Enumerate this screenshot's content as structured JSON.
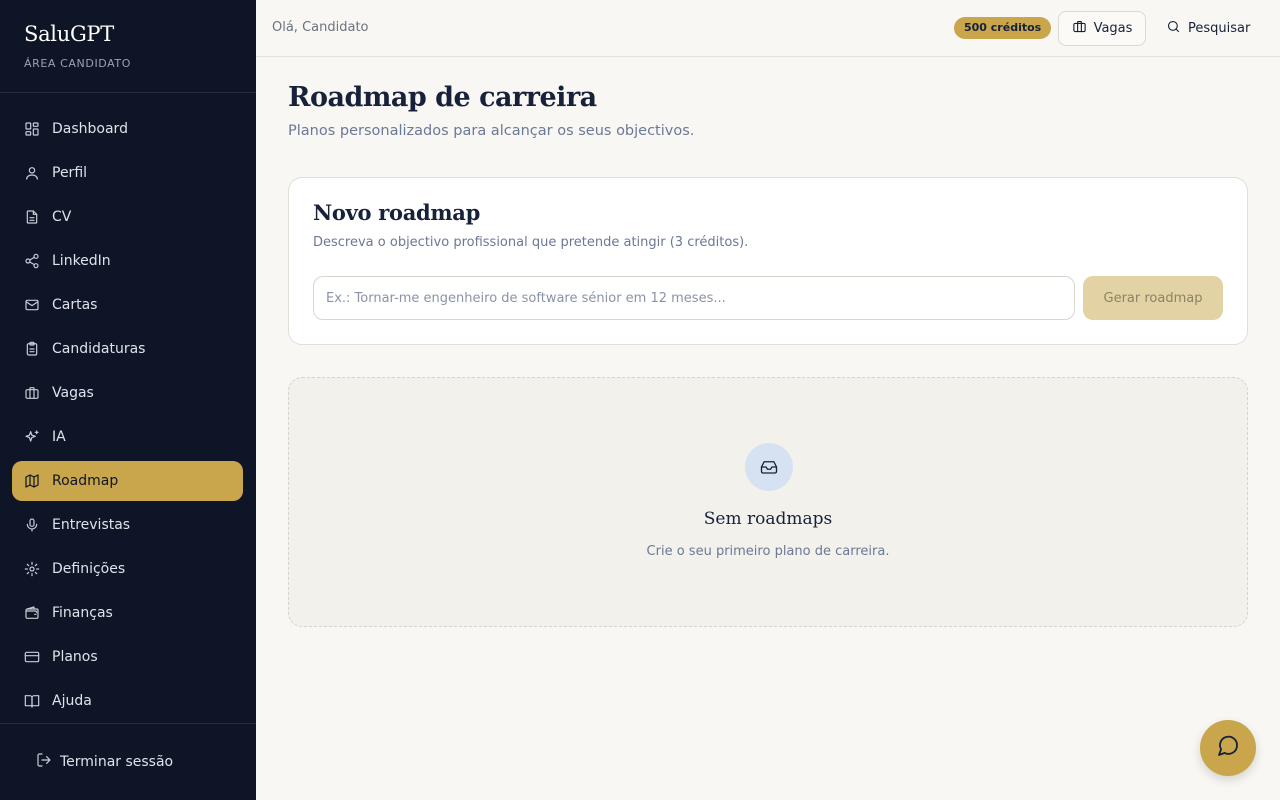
{
  "brand": {
    "name": "SaluGPT",
    "area": "ÁREA CANDIDATO"
  },
  "sidebar": {
    "items": [
      {
        "label": "Dashboard",
        "icon": "dashboard-icon",
        "active": false
      },
      {
        "label": "Perfil",
        "icon": "user-icon",
        "active": false
      },
      {
        "label": "CV",
        "icon": "file-text-icon",
        "active": false
      },
      {
        "label": "LinkedIn",
        "icon": "share-icon",
        "active": false
      },
      {
        "label": "Cartas",
        "icon": "mail-icon",
        "active": false
      },
      {
        "label": "Candidaturas",
        "icon": "clipboard-icon",
        "active": false
      },
      {
        "label": "Vagas",
        "icon": "briefcase-icon",
        "active": false
      },
      {
        "label": "IA",
        "icon": "sparkles-icon",
        "active": false
      },
      {
        "label": "Roadmap",
        "icon": "map-icon",
        "active": true
      },
      {
        "label": "Entrevistas",
        "icon": "mic-icon",
        "active": false
      },
      {
        "label": "Definições",
        "icon": "settings-icon",
        "active": false
      },
      {
        "label": "Finanças",
        "icon": "wallet-icon",
        "active": false
      },
      {
        "label": "Planos",
        "icon": "credit-card-icon",
        "active": false
      },
      {
        "label": "Ajuda",
        "icon": "book-icon",
        "active": false
      }
    ],
    "logout_label": "Terminar sessão"
  },
  "topbar": {
    "greeting": "Olá, Candidato",
    "credits": "500 créditos",
    "vagas_label": "Vagas",
    "search_label": "Pesquisar"
  },
  "main": {
    "title": "Roadmap de carreira",
    "subtitle": "Planos personalizados para alcançar os seus objectivos.",
    "card": {
      "title": "Novo roadmap",
      "subtitle": "Descreva o objectivo profissional que pretende atingir (3 créditos).",
      "input_value": "",
      "input_placeholder": "Ex.: Tornar-me engenheiro de software sénior em 12 meses...",
      "button_label": "Gerar roadmap"
    },
    "empty": {
      "title": "Sem roadmaps",
      "subtitle": "Crie o seu primeiro plano de carreira.",
      "icon": "inbox-icon"
    }
  },
  "colors": {
    "sidebar_bg": "#0e1526",
    "accent": "#c9a54c",
    "page_bg": "#f8f7f3",
    "text": "#17213a"
  }
}
